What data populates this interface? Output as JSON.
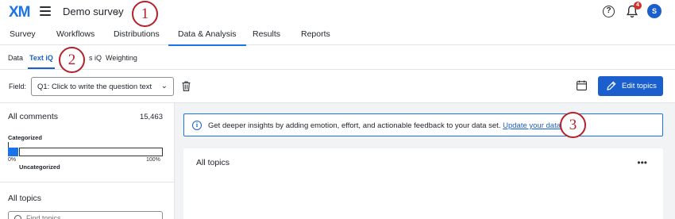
{
  "header": {
    "logo_text": "XM",
    "project_title": "Demo survey",
    "notification_count": "4",
    "avatar_initial": "S",
    "help_glyph": "?"
  },
  "annotations": {
    "step1": "1",
    "step2": "2",
    "step3": "3"
  },
  "nav": {
    "tabs": [
      {
        "label": "Survey"
      },
      {
        "label": "Workflows"
      },
      {
        "label": "Distributions"
      },
      {
        "label": "Data & Analysis",
        "active": true
      },
      {
        "label": "Results"
      },
      {
        "label": "Reports"
      }
    ]
  },
  "subnav": {
    "tabs": [
      {
        "label": "Data"
      },
      {
        "label": "Text iQ",
        "active": true
      },
      {
        "label": "s iQ"
      },
      {
        "label": "Weighting"
      }
    ]
  },
  "toolbar": {
    "field_label": "Field:",
    "field_value": "Q1: Click to write the question text",
    "edit_topics_label": "Edit topics"
  },
  "sidebar": {
    "all_comments_label": "All comments",
    "all_comments_count": "15,463",
    "categorized_label": "Categorized",
    "uncategorized_label": "Uncategorized",
    "categorized_fraction": 0,
    "scale_min": "0%",
    "scale_max": "100%",
    "all_topics_label": "All topics",
    "search_placeholder": "Find topics"
  },
  "main": {
    "banner_text": "Get deeper insights by adding emotion, effort, and actionable feedback to your data set.",
    "banner_link": "Update your data set",
    "card_title": "All topics",
    "more_glyph": "•••"
  },
  "colors": {
    "accent": "#1a5fcd",
    "annotation": "#b3212a",
    "badge": "#d0312d"
  }
}
